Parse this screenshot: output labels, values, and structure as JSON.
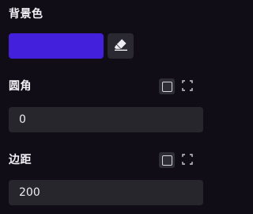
{
  "background": {
    "label": "背景色",
    "color": "#4321dc",
    "clear_icon": "eraser-icon"
  },
  "radius": {
    "label": "圆角",
    "value": "0",
    "mode_icons": [
      "uniform-square-icon",
      "individual-corners-icon"
    ]
  },
  "padding": {
    "label": "边距",
    "value": "200",
    "mode_icons": [
      "uniform-square-icon",
      "individual-sides-icon"
    ]
  },
  "colors": {
    "panel": "#110d17",
    "field": "#28262d",
    "button": "#2a2830"
  }
}
